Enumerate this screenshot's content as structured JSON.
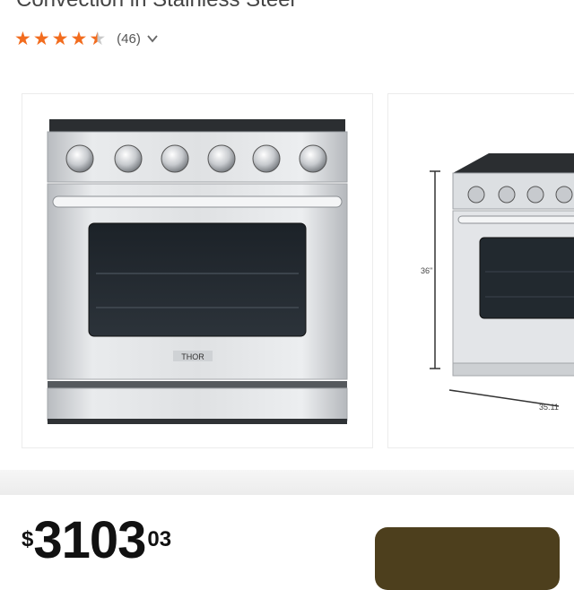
{
  "product": {
    "title": "Convection in Stainless Steel",
    "rating_value": 4.5,
    "rating_max": 5,
    "review_count": "(46)",
    "brand_badge": "THOR"
  },
  "gallery": {
    "images": [
      {
        "name": "front-view"
      },
      {
        "name": "side-view-dimensions"
      }
    ],
    "dimension_labels": {
      "height": "36\"",
      "width": "35.11"
    }
  },
  "price": {
    "currency": "$",
    "dollars": "3103",
    "cents": "03"
  },
  "icons": {
    "rating_dropdown": "chevron-down-icon"
  },
  "colors": {
    "star": "#f26c1e",
    "cta": "#4d3f1d"
  }
}
